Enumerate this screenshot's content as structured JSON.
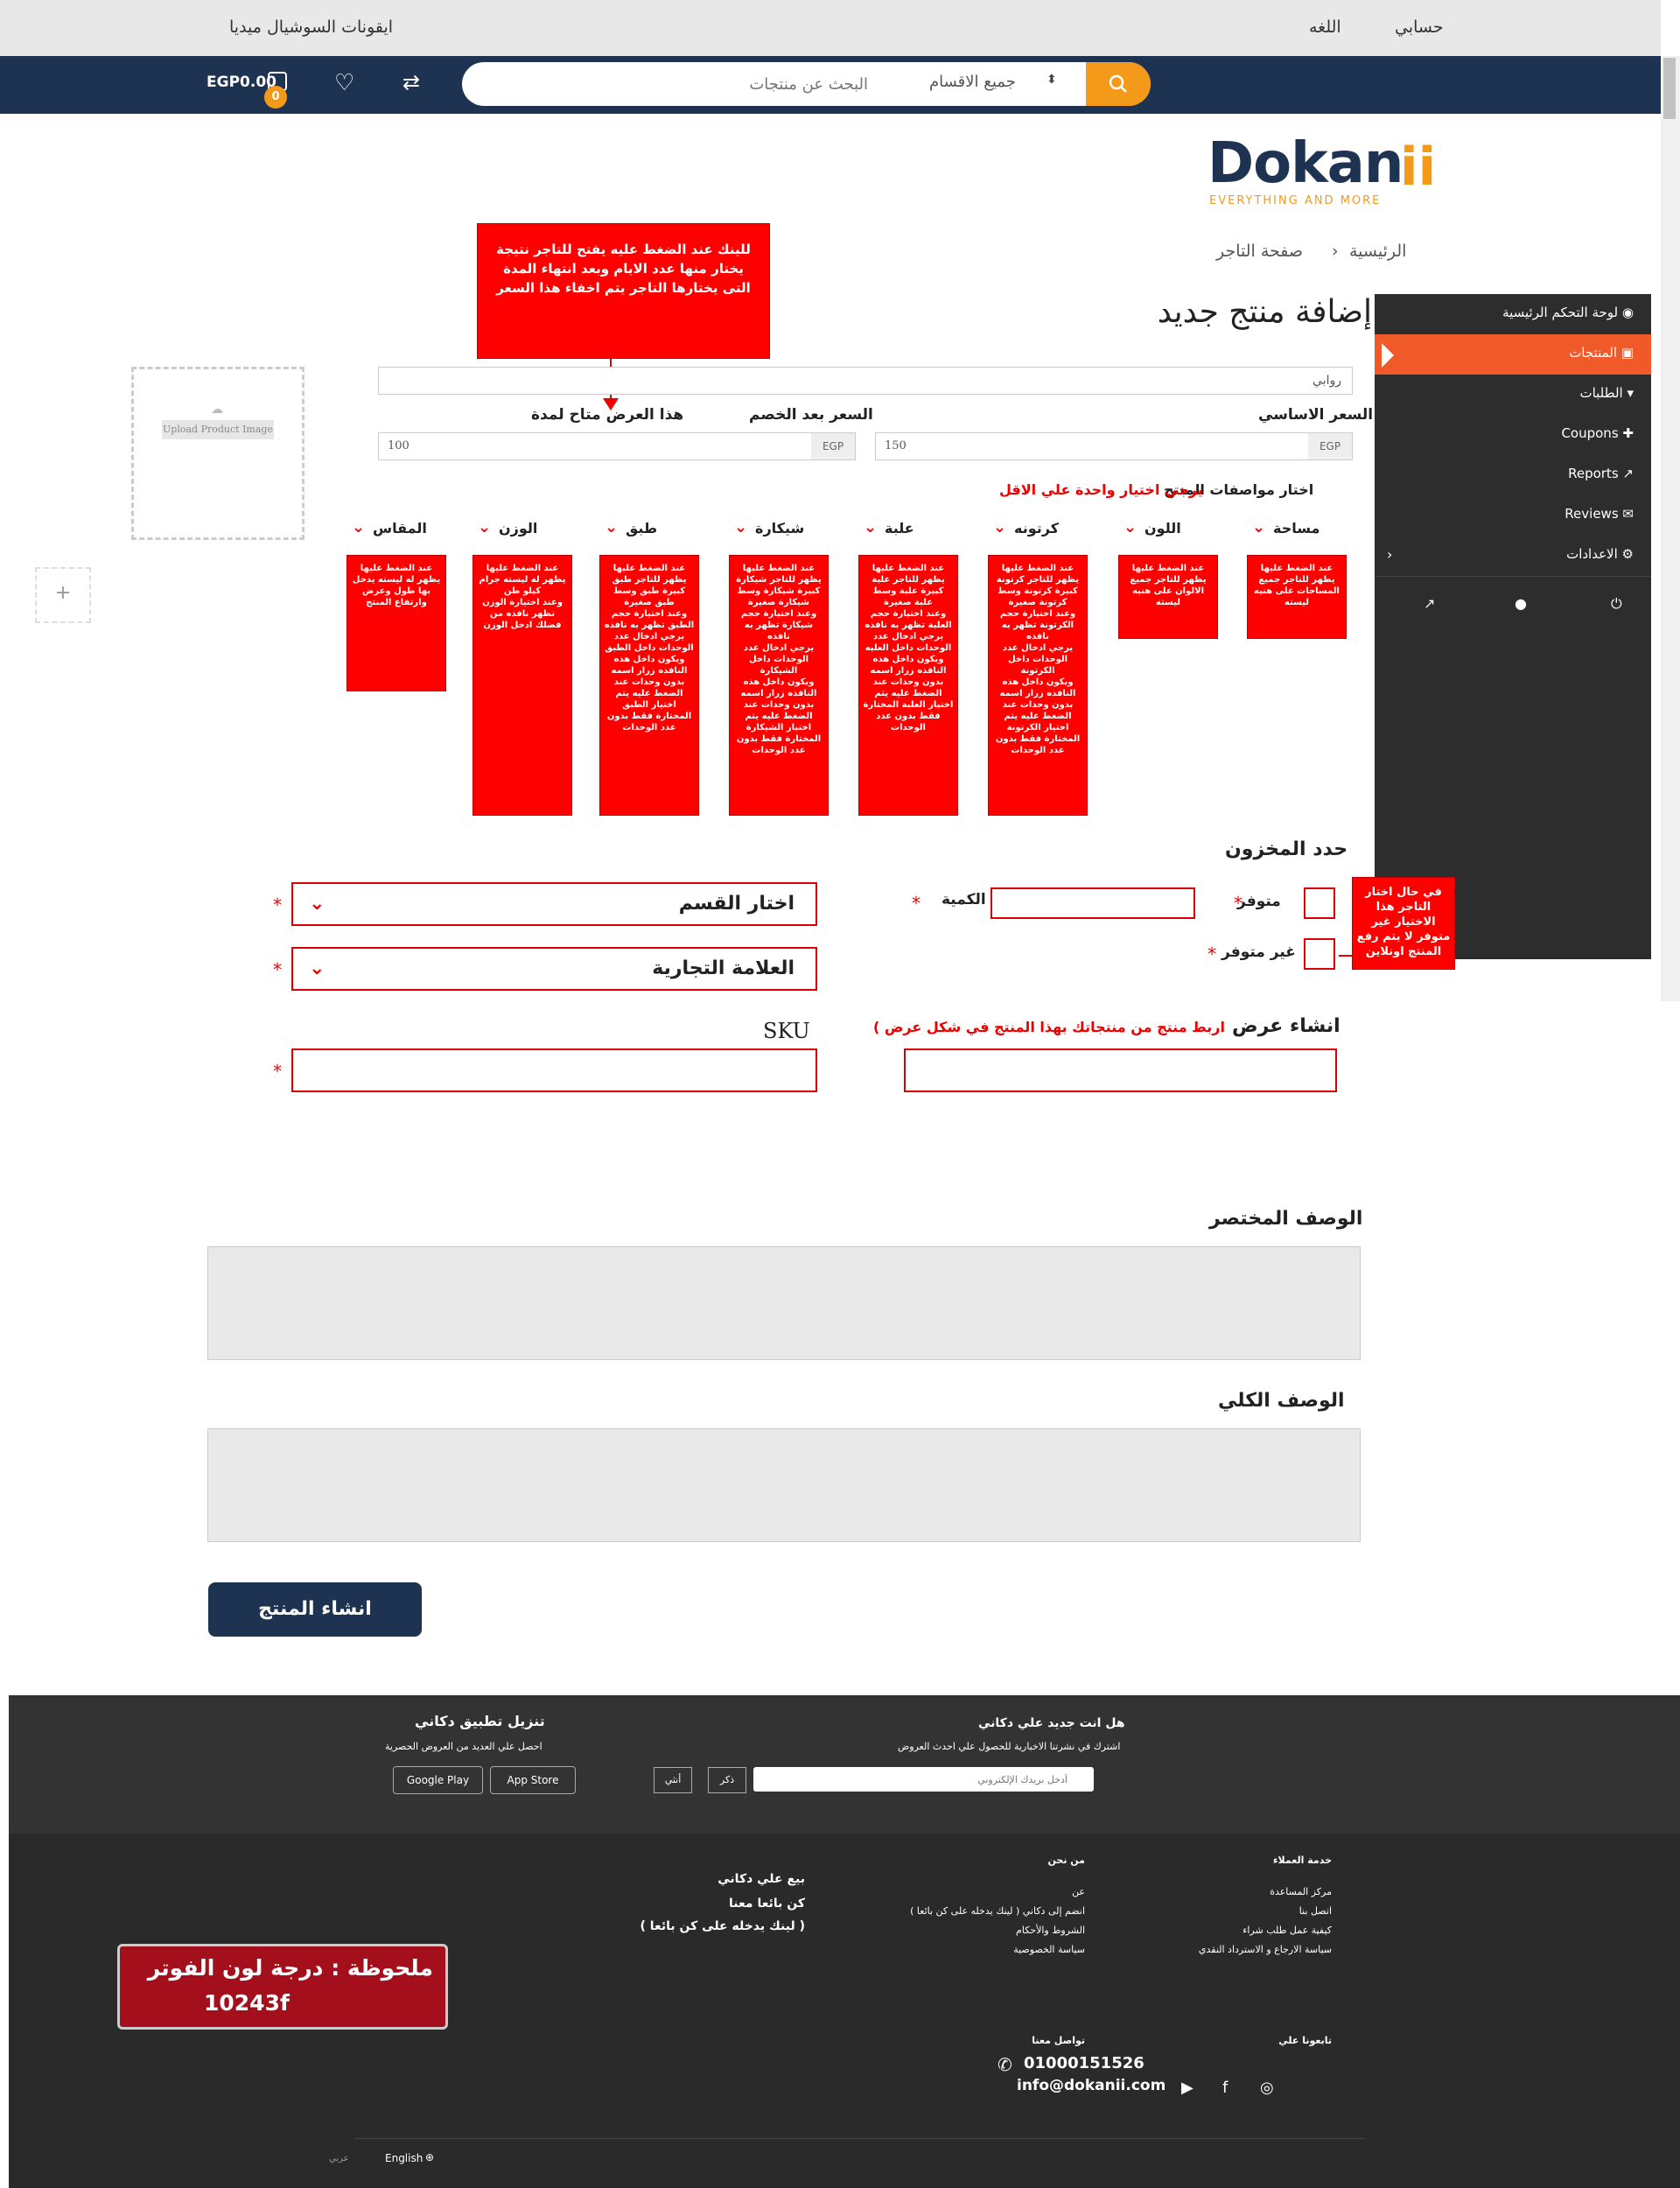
{
  "topbar": {
    "account": "حسابي",
    "language": "اللغه",
    "social": "ايقونات السوشيال ميديا"
  },
  "navbar": {
    "search_placeholder": "البحث عن منتجات",
    "category_select": "جميع الاقسام",
    "cart_total": "EGP0.00",
    "cart_count": "0"
  },
  "logo": {
    "text": "Dokan",
    "sub": "EVERYTHING AND MORE"
  },
  "breadcrumb": {
    "home": "الرئيسية",
    "separator": "›",
    "current": "صفحة التاجر"
  },
  "page_title": "إضافة منتج جديد",
  "sidebar": {
    "items": [
      {
        "label": "لوحة التحكم الرئيسية",
        "icon": "dashboard-icon"
      },
      {
        "label": "المنتجات",
        "icon": "briefcase-icon"
      },
      {
        "label": "الطلبات",
        "icon": "cart-icon"
      },
      {
        "label": "Coupons",
        "icon": "gift-icon"
      },
      {
        "label": "Reports",
        "icon": "chart-icon"
      },
      {
        "label": "Reviews",
        "icon": "comments-icon"
      },
      {
        "label": "الاعدادات",
        "icon": "gear-icon"
      }
    ]
  },
  "callouts": {
    "link_note": "للينك عند الضغط عليه يفتح للتاجر نتيجة يختار منها عدد الايام وبعد انتهاء المدة التى يختارها التاجر يتم اخفاء هذا السعر",
    "out_of_stock_note": "في حال اختار التاجر هذا الاختيار غير متوفر لا يتم رفع المنتج اونلاين",
    "footer_note_line1": "ملحوظة : درجة لون الفوتر",
    "footer_note_line2": "10243f"
  },
  "form": {
    "product_name_value": "روابي",
    "base_price_label": "السعر الاساسي",
    "sale_price_label": "السعر بعد الخصم",
    "offer_period_label": "هذا العرض متاح لمدة",
    "currency": "EGP",
    "base_price_value": "150",
    "sale_price_value": "100",
    "upload_label": "Upload Product Image",
    "add_label": "+",
    "specs_label": "اختار مواصفات المنتج",
    "specs_note": "يرجي اختيار واحدة علي الاقل",
    "stock_title": "حدد المخزون",
    "in_stock": "متوفر",
    "out_stock": "غير متوفر",
    "quantity": "الكمية",
    "category": "اختار القسم",
    "brand": "العلامة التجارية",
    "offer_title": "انشاء عرض",
    "offer_note": "اربط منتج من منتجاتك بهذا المنتج في شكل عرض )",
    "sku": "SKU",
    "short_desc": "الوصف المختصر",
    "full_desc": "الوصف الكلي",
    "submit": "انشاء المنتج",
    "star": "*"
  },
  "attributes": [
    {
      "label": "مساحة",
      "note": "عند الضغط عليها يظهر للتاجر جميع المساحات على هنيه ليسته"
    },
    {
      "label": "اللون",
      "note": "عند الضغط عليها يظهر للتاجر جميع الالوان على هنيه ليسته"
    },
    {
      "label": "كرتونه",
      "note": "عند الضغط عليها يظهر للتاجر كرتونة كبيرة كرتونة وسط كرتونة صغيرة\nوعند اختيارة حجم الكرتونة تظهر به نافذه\nيرجي ادخال عدد الوحدات داخل الكرتونة\nويكون داخل هذه النافذه زرار اسمه بدون وحدات عند الضغط عليه يتم اختيار الكرتونة المختارة فقط بدون عدد الوحدات"
    },
    {
      "label": "علبة",
      "note": "عند الضغط عليها يظهر للتاجر علبة كبيرة علبة وسط علبة صغيرة\nوعند اختيارة حجم العلبة تظهر به نافذه\nيرجي ادخال عدد الوحدات داخل العلبه\nويكون داخل هذه النافذه زرار اسمه بدون وحدات عند الضغط عليه يتم اختيار العلبة المختارة فقط بدون عدد الوحدات"
    },
    {
      "label": "شيكارة",
      "note": "عند الضغط عليها يظهر للتاجر شيكارة كبيرة شيكارة وسط شيكارة صغيرة\nوعند اختيارة حجم شيكارة تظهر به نافذه\nيرجي ادخال عدد الوحدات داخل الشيكارة\nويكون داخل هذه النافذه زرار اسمه بدون وحدات عند الضغط عليه يتم اختيار الشيكارة المختارة فقط بدون عدد الوحدات"
    },
    {
      "label": "طبق",
      "note": "عند الضغط عليها يظهر للتاجر طبق كبيرة طبق وسط طبق صغيرة\nوعند اختيارة حجم الطبق تظهر به نافذه\nيرجي ادخال عدد الوحدات داخل الطبق\nويكون داخل هذه النافذه زرار اسمه بدون وحدات عند الضغط عليه يتم اختيار الطبق المختارة فقط بدون عدد الوحدات"
    },
    {
      "label": "الوزن",
      "note": "عند الضغط عليها يظهر له ليسته جرام كيلو طن\nوعند اختيارة الوزن تظهر نافذه من فضلك ادخل الوزن"
    },
    {
      "label": "المقاس",
      "note": "عند الضغط عليها يظهر له ليسته يدخل بها طول وعرض وارتفاع المنتج"
    }
  ],
  "footer": {
    "newsletter_title": "هل انت جديد علي دكاني",
    "newsletter_sub": "اشترك في نشرتنا الاخبارية للحصول علي احدث العروض",
    "email_placeholder": "أدخل بريدك الإلكتروني",
    "male": "ذكر",
    "female": "أنثي",
    "app_title": "تنزيل تطبيق دكاني",
    "app_sub": "احصل علي العديد من العروض الحصرية",
    "google_play": "Google Play",
    "app_store": "App Store",
    "col1_title": "خدمة العملاء",
    "col1_items": [
      "مركز المساعدة",
      "اتصل بنا",
      "كيفية عمل طلب شراء",
      "سياسة الارجاع و الاسترداد النقدي"
    ],
    "col2_title": "من نحن",
    "col2_items": [
      "عن",
      "انضم إلى دكاني ( لينك يدخله على كن بائعا )",
      "الشروط والأحكام",
      "سياسة الخصوصية"
    ],
    "sell_title": "بيع علي دكاني",
    "sell_item": "كن بائعا معنا",
    "sell_link": "( لينك يدخله على كن بائعا )",
    "follow": "تابعونا علي",
    "contact": "تواصل معنا",
    "phone": "01000151526",
    "email": "info@dokanii.com",
    "lang_en": "English",
    "lang_ar": "عربي"
  }
}
